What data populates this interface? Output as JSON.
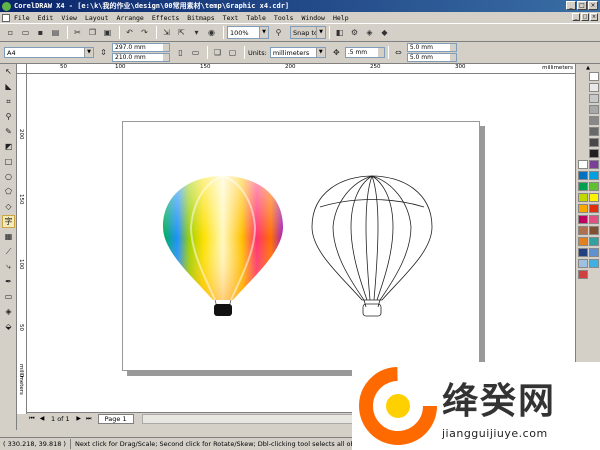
{
  "window": {
    "title": "CorelDRAW X4 - [e:\\k\\我的作业\\design\\00常用素材\\temp\\Graphic x4.cdr]",
    "controls": [
      "_",
      "□",
      "×"
    ]
  },
  "menu": {
    "items": [
      "File",
      "Edit",
      "View",
      "Layout",
      "Arrange",
      "Effects",
      "Bitmaps",
      "Text",
      "Table",
      "Tools",
      "Window",
      "Help"
    ]
  },
  "toolbar": {
    "zoom_value": "100%",
    "snap_label": "Snap to"
  },
  "propbar": {
    "paper_size": "A4",
    "width": "297.0 mm",
    "height": "210.0 mm",
    "units_label": "Units:",
    "units_value": "millimeters",
    "nudge": ".5 mm",
    "dup_x": "5.0 mm",
    "dup_y": "5.0 mm"
  },
  "ruler": {
    "unit": "millimeters",
    "h_ticks": [
      "50",
      "100",
      "150",
      "200",
      "250",
      "300"
    ],
    "v_ticks": [
      "200",
      "150",
      "100",
      "50",
      "0"
    ]
  },
  "pagenav": {
    "counter": "1 of 1",
    "tab": "Page 1"
  },
  "status": {
    "coords": "( 330.218, 39.818 )",
    "hint": "Next click for Drag/Scale; Second click for Rotate/Skew; Dbl-clicking tool selects all objects; Shift+cli"
  },
  "palette": {
    "colors": [
      "#ffffff",
      "#e8e8e8",
      "#c8c8c8",
      "#a8a8a8",
      "#888888",
      "#686868",
      "#484848",
      "#202020",
      "#ffffff",
      "#7b3f98",
      "#0070c0",
      "#00a0e0",
      "#00a050",
      "#60c030",
      "#c0d800",
      "#fff200",
      "#f7a800",
      "#e03010",
      "#c00060",
      "#e05080",
      "#b07050",
      "#805030",
      "#e08020",
      "#30a0a0",
      "#204080",
      "#6090d0",
      "#a0c0e0",
      "#40b0e0",
      "#d04040"
    ]
  },
  "watermark": {
    "brand": "绛癸网",
    "url": "jiangguijiuye.com"
  }
}
